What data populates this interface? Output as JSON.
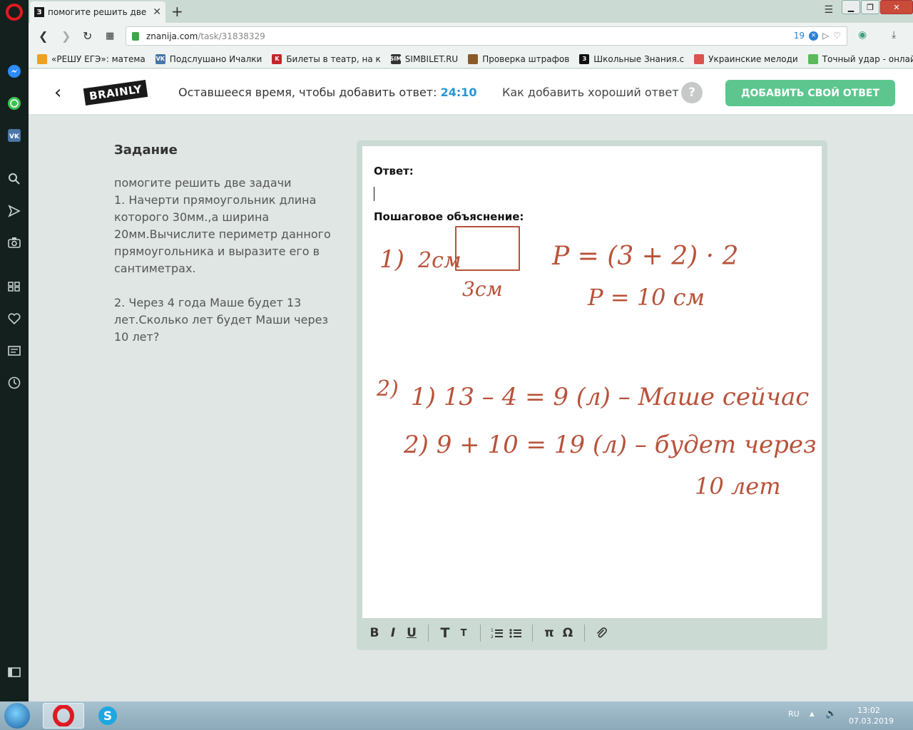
{
  "browser": {
    "tab": {
      "title": "помогите решить две задачи",
      "favicon": "З"
    },
    "new_tab_symbol": "+",
    "address": {
      "host": "znanija.com",
      "path": "/task/31838329",
      "adblock_count": "19",
      "adblock_badge": "×"
    },
    "bookmarks": [
      {
        "label": "«РЕШУ ЕГЭ»: матема",
        "icon": "sun-icon",
        "color": "#f0a020",
        "glyph": ""
      },
      {
        "label": "Подслушано Ичалки",
        "icon": "vk-icon",
        "color": "#4a76a8",
        "glyph": "VK"
      },
      {
        "label": "Билеты в театр, на к",
        "icon": "ticket-icon",
        "color": "#c3262b",
        "glyph": "K"
      },
      {
        "label": "SIMBILET.RU",
        "icon": "sim-icon",
        "color": "#333333",
        "glyph": "SIM"
      },
      {
        "label": "Проверка штрафов",
        "icon": "badge-icon",
        "color": "#8a5a2a",
        "glyph": ""
      },
      {
        "label": "Школьные Знания.c",
        "icon": "znanija-icon",
        "color": "#111111",
        "glyph": "З"
      },
      {
        "label": "Украинские мелоди",
        "icon": "music-icon",
        "color": "#d9534f",
        "glyph": ""
      },
      {
        "label": "Точный удар - онлай",
        "icon": "game-icon",
        "color": "#5cb85c",
        "glyph": ""
      }
    ]
  },
  "header": {
    "back_symbol": "‹",
    "logo": "BRAINLY",
    "timer_label": "Оставшееся время, чтобы добавить ответ:",
    "timer_value": "24:10",
    "howto": "Как добавить хороший ответ",
    "help_symbol": "?",
    "add_answer": "ДОБАВИТЬ СВОЙ ОТВЕТ"
  },
  "task": {
    "heading": "Задание",
    "lines": [
      "помогите решить две задачи",
      "1. Начерти прямоугольник длина которого 30мм.,а ширина 20мм.Вычислите периметр данного прямоугольника и выразите его в сантиметрах.",
      "",
      "2. Через 4 года Маше будет 13 лет.Сколько лет будет Маши через 10 лет?"
    ]
  },
  "editor": {
    "answer_label": "Ответ:",
    "explanation_label": "Пошаговое объяснение:",
    "handwriting": {
      "ink_color": "#b8523a",
      "p1_number": "1)",
      "p1_side": "2см",
      "p1_bottom": "3см",
      "p1_formula": "P = (3 + 2) · 2",
      "p1_result": "P = 10 см",
      "p2_number": "2)",
      "p2_line1": "1) 13 – 4 = 9 (л) – Маше сейчас",
      "p2_line2": "2) 9 + 10 = 19 (л) – будет через",
      "p2_line3": "10 лет"
    },
    "toolbar": {
      "bold": "B",
      "italic": "I",
      "underline": "U",
      "text_large": "T",
      "text_small": "T",
      "pi": "π",
      "omega": "Ω"
    }
  },
  "taskbar": {
    "lang": "RU",
    "time": "13:02",
    "date": "07.03.2019"
  }
}
